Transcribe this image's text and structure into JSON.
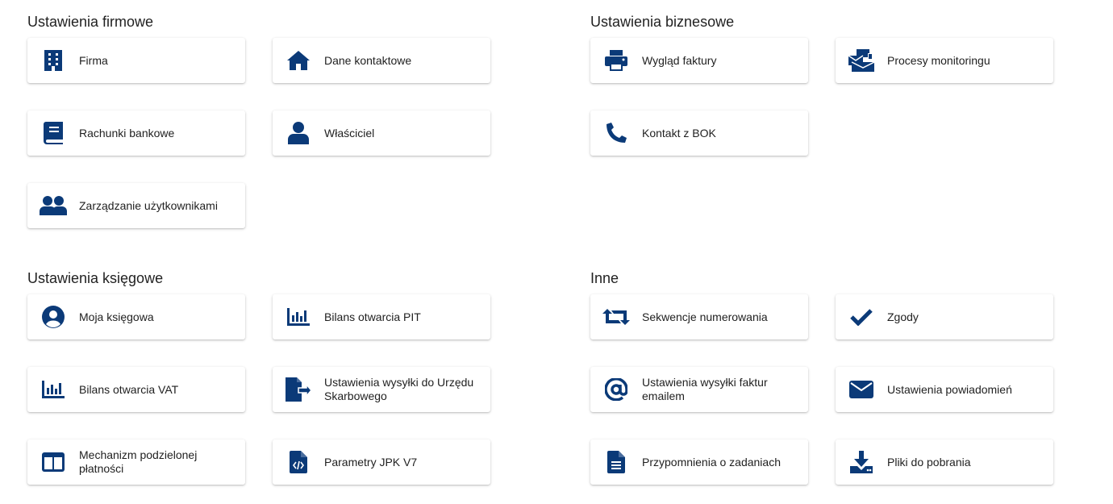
{
  "colors": {
    "icon": "#0b3a78"
  },
  "sections": {
    "firmowe": {
      "title": "Ustawienia firmowe",
      "items": [
        {
          "label": "Firma",
          "icon": "building-icon"
        },
        {
          "label": "Dane kontaktowe",
          "icon": "home-icon"
        },
        {
          "label": "Rachunki bankowe",
          "icon": "book-icon"
        },
        {
          "label": "Właściciel",
          "icon": "user-icon"
        },
        {
          "label": "Zarządzanie użytkownikami",
          "icon": "users-icon"
        }
      ]
    },
    "biznesowe": {
      "title": "Ustawienia biznesowe",
      "items": [
        {
          "label": "Wygląd faktury",
          "icon": "print-icon"
        },
        {
          "label": "Procesy monitoringu",
          "icon": "mail-bulk-icon"
        },
        {
          "label": "Kontakt z BOK",
          "icon": "phone-icon"
        }
      ]
    },
    "ksiegowe": {
      "title": "Ustawienia księgowe",
      "items": [
        {
          "label": "Moja księgowa",
          "icon": "user-circle-icon"
        },
        {
          "label": "Bilans otwarcia PIT",
          "icon": "bar-chart-icon"
        },
        {
          "label": "Bilans otwarcia VAT",
          "icon": "bar-chart-icon"
        },
        {
          "label": "Ustawienia wysyłki do Urzędu Skarbowego",
          "icon": "file-export-icon"
        },
        {
          "label": "Mechanizm podzielonej płatności",
          "icon": "columns-icon"
        },
        {
          "label": "Parametry JPK V7",
          "icon": "file-code-icon"
        }
      ]
    },
    "inne": {
      "title": "Inne",
      "items": [
        {
          "label": "Sekwencje numerowania",
          "icon": "retweet-icon"
        },
        {
          "label": "Zgody",
          "icon": "check-icon"
        },
        {
          "label": "Ustawienia wysyłki faktur emailem",
          "icon": "at-icon"
        },
        {
          "label": "Ustawienia powiadomień",
          "icon": "envelope-icon"
        },
        {
          "label": "Przypomnienia o zadaniach",
          "icon": "file-text-icon"
        },
        {
          "label": "Pliki do pobrania",
          "icon": "download-icon"
        }
      ]
    }
  }
}
